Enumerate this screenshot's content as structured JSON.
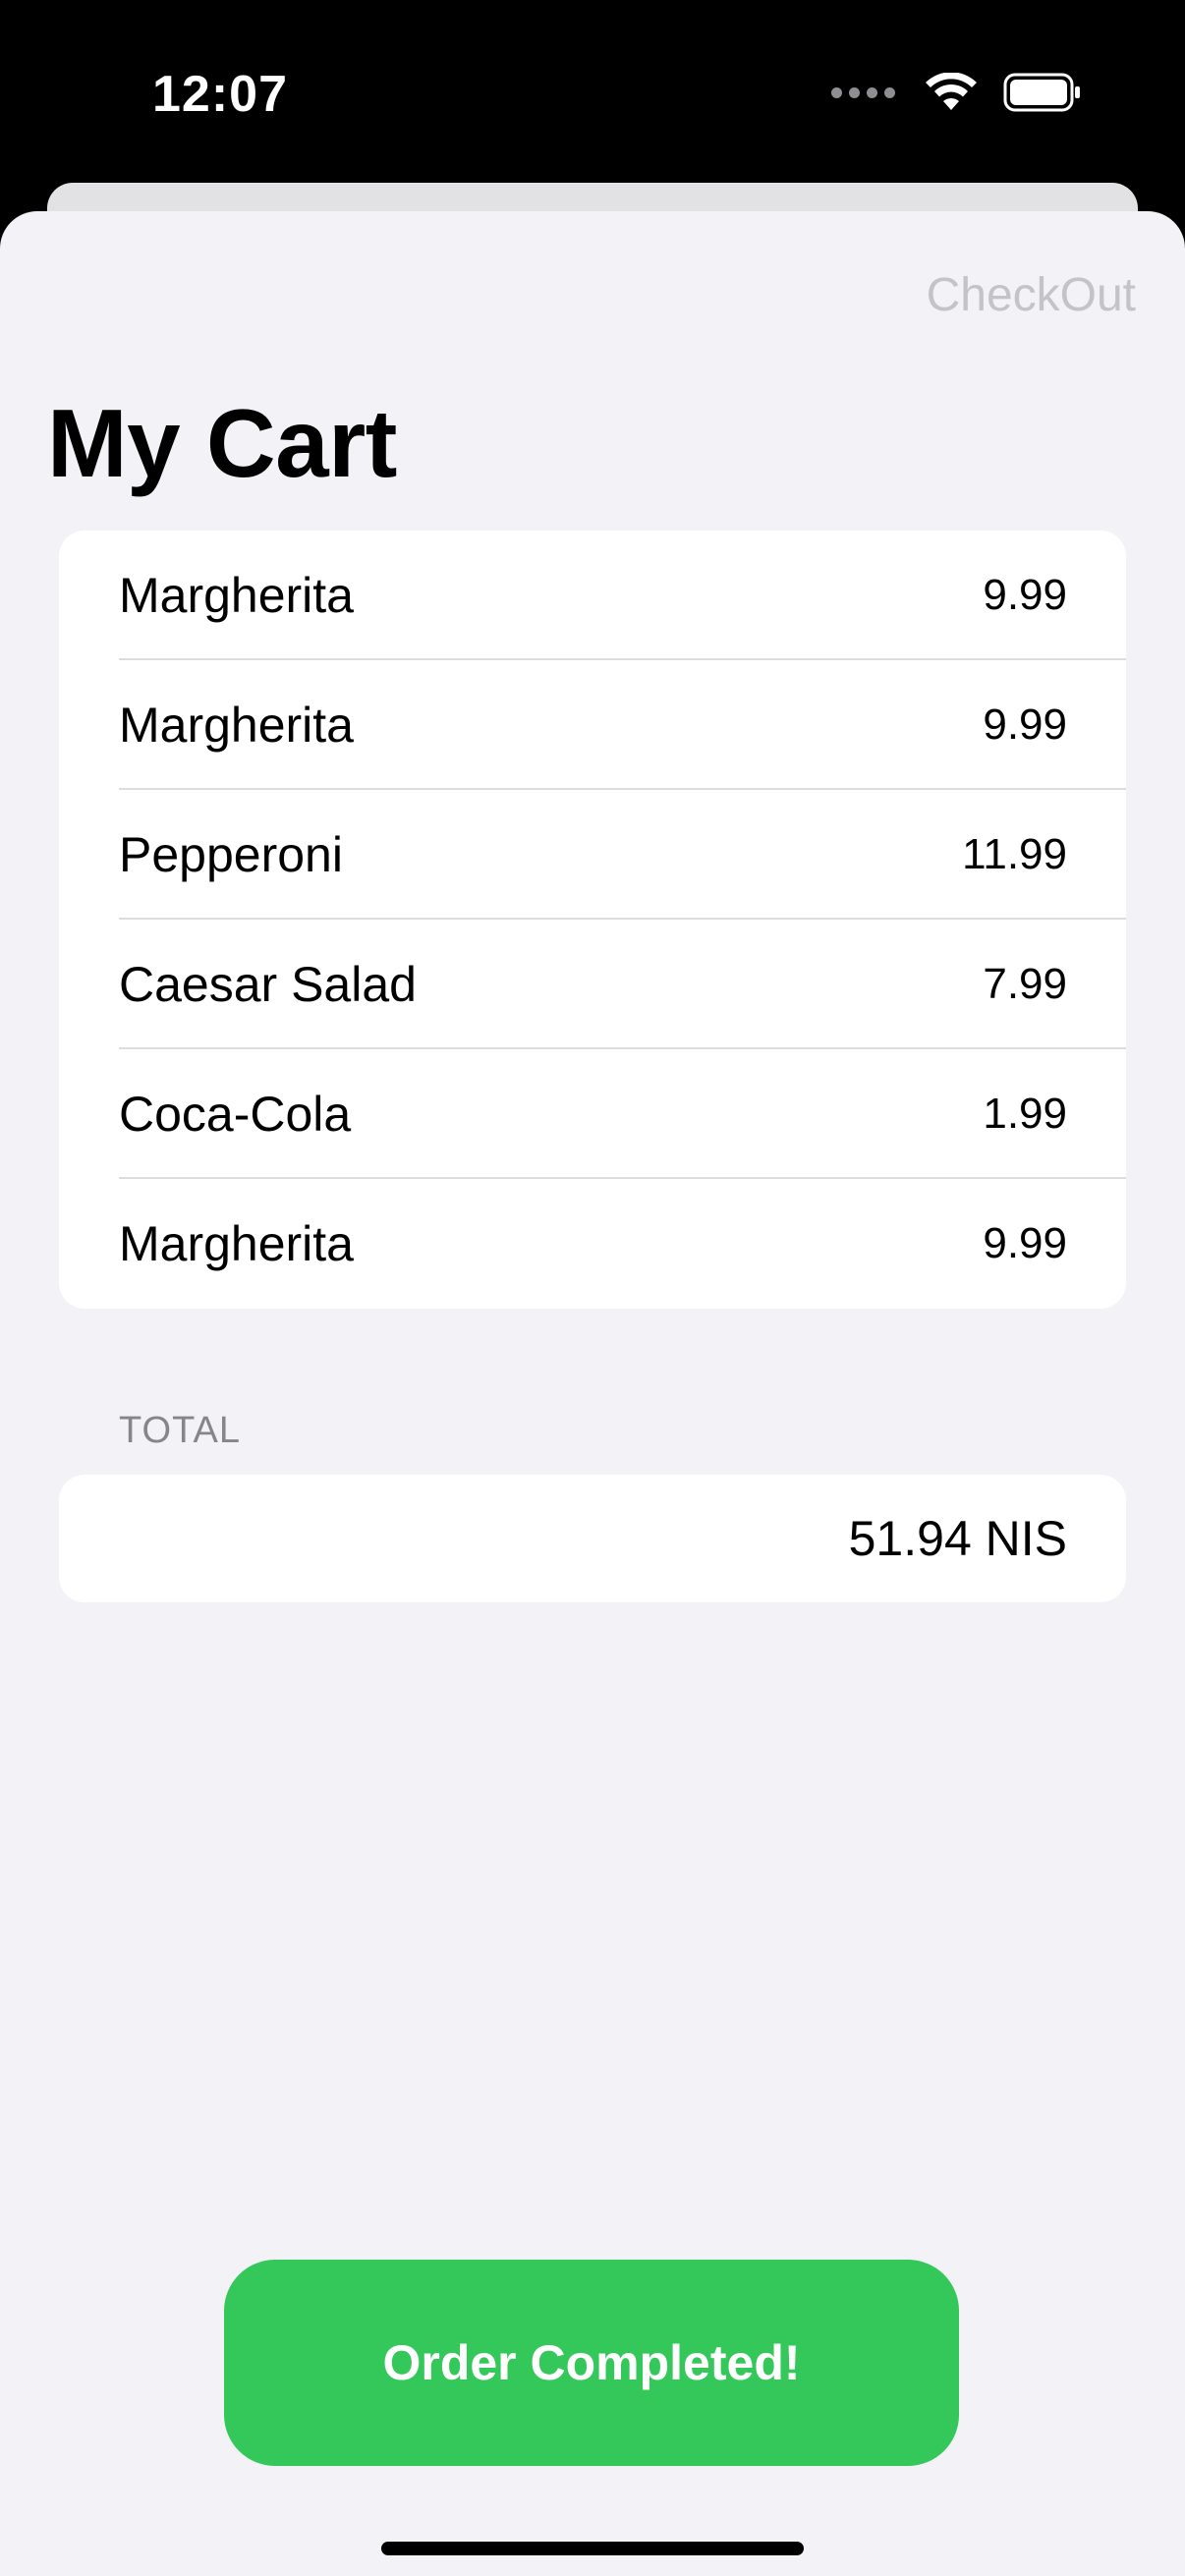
{
  "status_bar": {
    "time": "12:07"
  },
  "nav": {
    "checkout_label": "CheckOut"
  },
  "page": {
    "title": "My Cart"
  },
  "cart": {
    "items": [
      {
        "name": "Margherita",
        "price": "9.99"
      },
      {
        "name": "Margherita",
        "price": "9.99"
      },
      {
        "name": "Pepperoni",
        "price": "11.99"
      },
      {
        "name": "Caesar Salad",
        "price": "7.99"
      },
      {
        "name": "Coca-Cola",
        "price": "1.99"
      },
      {
        "name": "Margherita",
        "price": "9.99"
      }
    ]
  },
  "total": {
    "header": "TOTAL",
    "value": "51.94 NIS"
  },
  "actions": {
    "order_button_label": "Order Completed!"
  },
  "colors": {
    "accent_green": "#34c759",
    "background": "#f2f2f7",
    "disabled_text": "#c4c4c8"
  },
  "icons": [
    "cellular-dots-icon",
    "wifi-icon",
    "battery-icon"
  ]
}
